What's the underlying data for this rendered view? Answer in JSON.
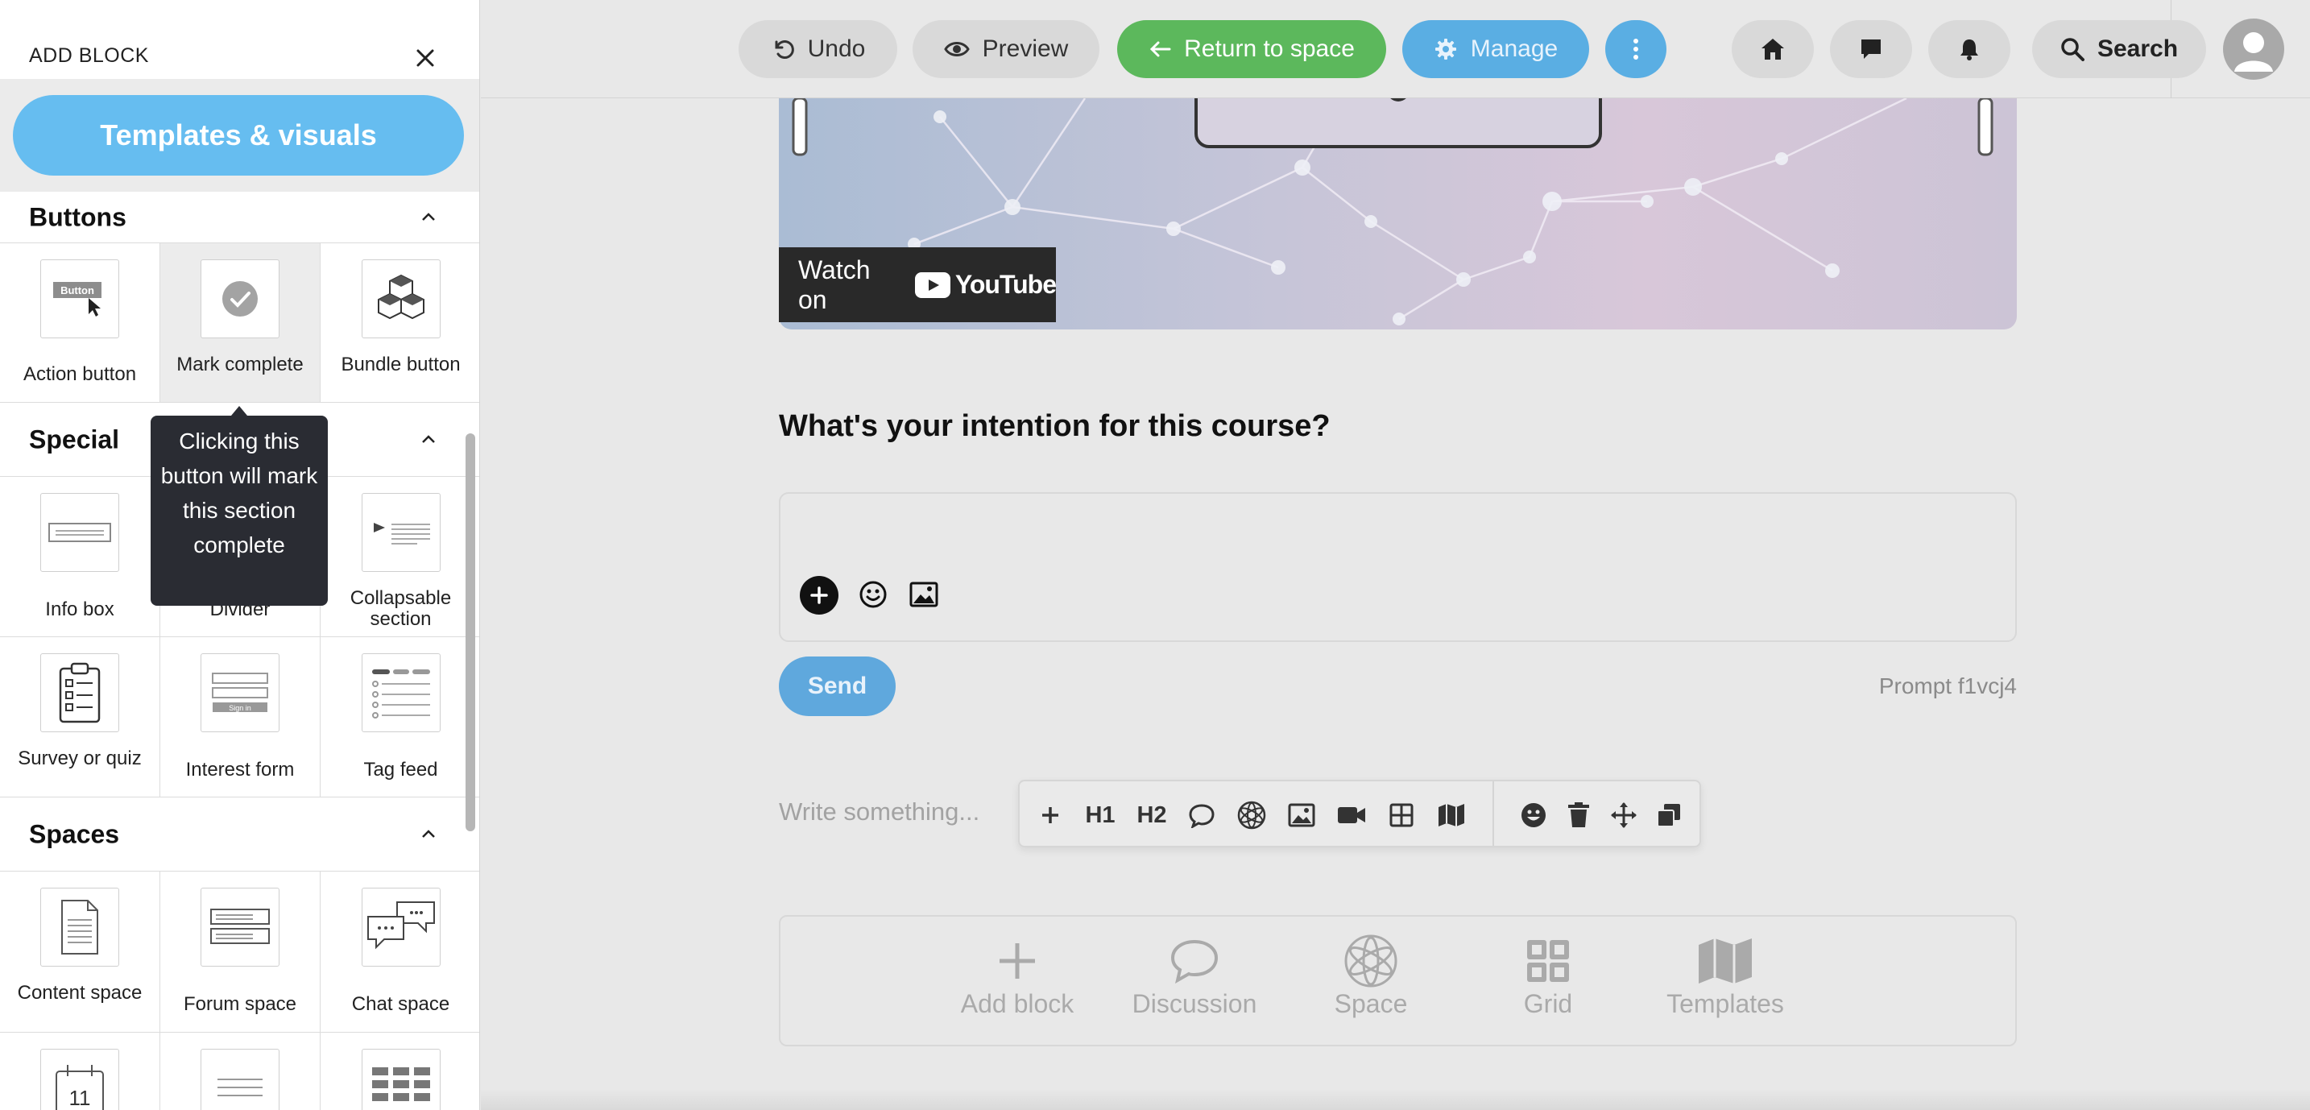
{
  "sidebar": {
    "title": "ADD BLOCK",
    "templates_button": "Templates & visuals",
    "sections": [
      {
        "title": "Buttons",
        "tiles": [
          {
            "label": "Action button",
            "icon_label": "Button"
          },
          {
            "label": "Mark complete"
          },
          {
            "label": "Bundle button"
          }
        ]
      },
      {
        "title": "Special",
        "tiles": [
          {
            "label": "Info box"
          },
          {
            "label": "Divider"
          },
          {
            "label": "Collapsable section"
          },
          {
            "label": "Survey or quiz"
          },
          {
            "label": "Interest form",
            "icon_label": "Sign in"
          },
          {
            "label": "Tag feed"
          }
        ]
      },
      {
        "title": "Spaces",
        "tiles": [
          {
            "label": "Content space"
          },
          {
            "label": "Forum space"
          },
          {
            "label": "Chat space"
          },
          {
            "label": "",
            "icon_label": "11"
          }
        ]
      }
    ],
    "tooltip": "Clicking this button will mark this section complete"
  },
  "topbar": {
    "undo": "Undo",
    "preview": "Preview",
    "return": "Return to space",
    "manage": "Manage",
    "search": "Search"
  },
  "content": {
    "watch_on": "Watch on",
    "youtube": "YouTube",
    "question": "What's your intention for this course?",
    "send": "Send",
    "prompt_id": "Prompt f1vcj4",
    "write_placeholder": "Write something...",
    "toolbar": {
      "h1": "H1",
      "h2": "H2"
    },
    "blockbar": [
      "Add block",
      "Discussion",
      "Space",
      "Grid",
      "Templates"
    ]
  },
  "colors": {
    "accent_blue": "#66bdf0",
    "return_green": "#5cb85c",
    "manage_blue": "#5aaee3",
    "tooltip_bg": "#2a2c33"
  }
}
